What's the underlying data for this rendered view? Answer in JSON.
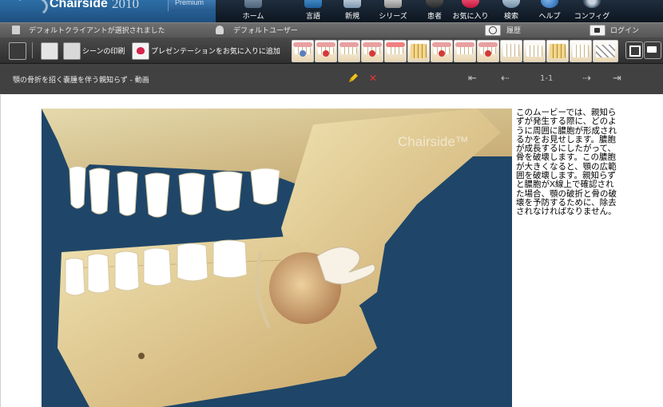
{
  "app": {
    "brand": "Chairside",
    "year": "2010",
    "edition": "Premium"
  },
  "nav": [
    {
      "label": "ホーム",
      "icon": "home-icon"
    },
    {
      "label": "言語",
      "icon": "language-icon"
    },
    {
      "label": "新規",
      "icon": "new-icon"
    },
    {
      "label": "シリーズ",
      "icon": "series-icon"
    },
    {
      "label": "患者",
      "icon": "patient-icon"
    },
    {
      "label": "お気に入り",
      "icon": "favorites-icon"
    },
    {
      "label": "検索",
      "icon": "search-icon"
    },
    {
      "label": "ヘルプ",
      "icon": "help-icon"
    },
    {
      "label": "コンフィグ",
      "icon": "config-icon"
    }
  ],
  "status": {
    "client": "デフォルトクライアントが選択されました",
    "user": "デフォルトユーザー",
    "history": "履歴",
    "login": "ログイン"
  },
  "toolbar": {
    "print": "シーンの印刷",
    "add_favorite": "プレゼンテーションをお気に入りに追加"
  },
  "presentation": {
    "title": "顎の骨折を招く嚢腫を伴う親知らず - 動画",
    "page": "1-1"
  },
  "video": {
    "watermark": "Chairside™"
  },
  "description": "このムービーでは、親知らずが発生する際に、どのように周囲に膿胞が形成されるかをお見せします。膿胞が成長するにしたがって、骨を破壊します。この膿胞が大きくなると、顎の広範囲を破壊します。親知らずと膿胞がX線上で確認された場合、顎の破折と骨の破壊を予防するために、除去されなければなりません。"
}
